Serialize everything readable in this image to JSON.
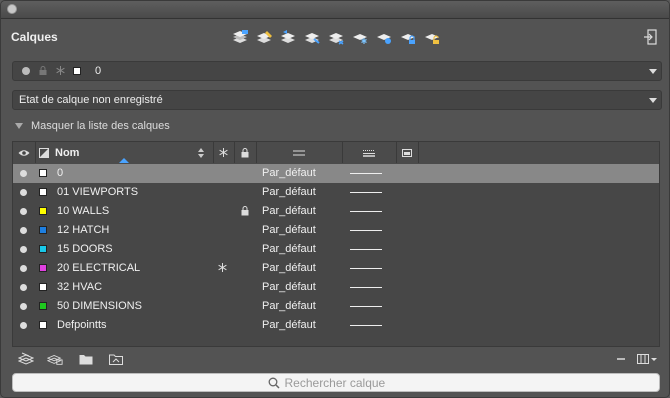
{
  "panel": {
    "title": "Calques"
  },
  "current_layer": {
    "name": "0",
    "color": "#ffffff"
  },
  "layer_state": {
    "value": "Etat de calque non enregistré"
  },
  "list_toggle": {
    "label": "Masquer la liste des calques"
  },
  "columns": {
    "name": "Nom"
  },
  "layers": [
    {
      "name": "0",
      "color": "#ffffff",
      "linetype": "Par_défaut",
      "locked": false,
      "frozen": false,
      "selected": true
    },
    {
      "name": "01 VIEWPORTS",
      "color": "#ffffff",
      "linetype": "Par_défaut",
      "locked": false,
      "frozen": false,
      "selected": false
    },
    {
      "name": "10 WALLS",
      "color": "#ffff00",
      "linetype": "Par_défaut",
      "locked": true,
      "frozen": false,
      "selected": false
    },
    {
      "name": "12 HATCH",
      "color": "#1e7fe0",
      "linetype": "Par_défaut",
      "locked": false,
      "frozen": false,
      "selected": false
    },
    {
      "name": "15 DOORS",
      "color": "#19c8e8",
      "linetype": "Par_défaut",
      "locked": false,
      "frozen": false,
      "selected": false
    },
    {
      "name": "20 ELECTRICAL",
      "color": "#e040e0",
      "linetype": "Par_défaut",
      "locked": false,
      "frozen": true,
      "selected": false
    },
    {
      "name": "32 HVAC",
      "color": "#ffffff",
      "linetype": "Par_défaut",
      "locked": false,
      "frozen": false,
      "selected": false
    },
    {
      "name": "50 DIMENSIONS",
      "color": "#1ec81e",
      "linetype": "Par_défaut",
      "locked": false,
      "frozen": false,
      "selected": false
    },
    {
      "name": "Defpointts",
      "color": "#ffffff",
      "linetype": "Par_défaut",
      "locked": false,
      "frozen": false,
      "selected": false
    }
  ],
  "search": {
    "placeholder": "Rechercher calque"
  },
  "icons": {
    "toolbar": [
      "layer-properties-icon",
      "layer-match-icon",
      "layer-previous-icon",
      "layer-isolate-icon",
      "layer-unisolate-icon",
      "layer-freeze-icon",
      "layer-off-icon",
      "layer-lock-icon",
      "layer-unlock-icon"
    ],
    "bottom": [
      "new-layer-icon",
      "new-layer-vp-frozen-icon",
      "open-folder-icon",
      "layer-folder-icon",
      "minus-icon",
      "columns-menu-icon"
    ]
  }
}
